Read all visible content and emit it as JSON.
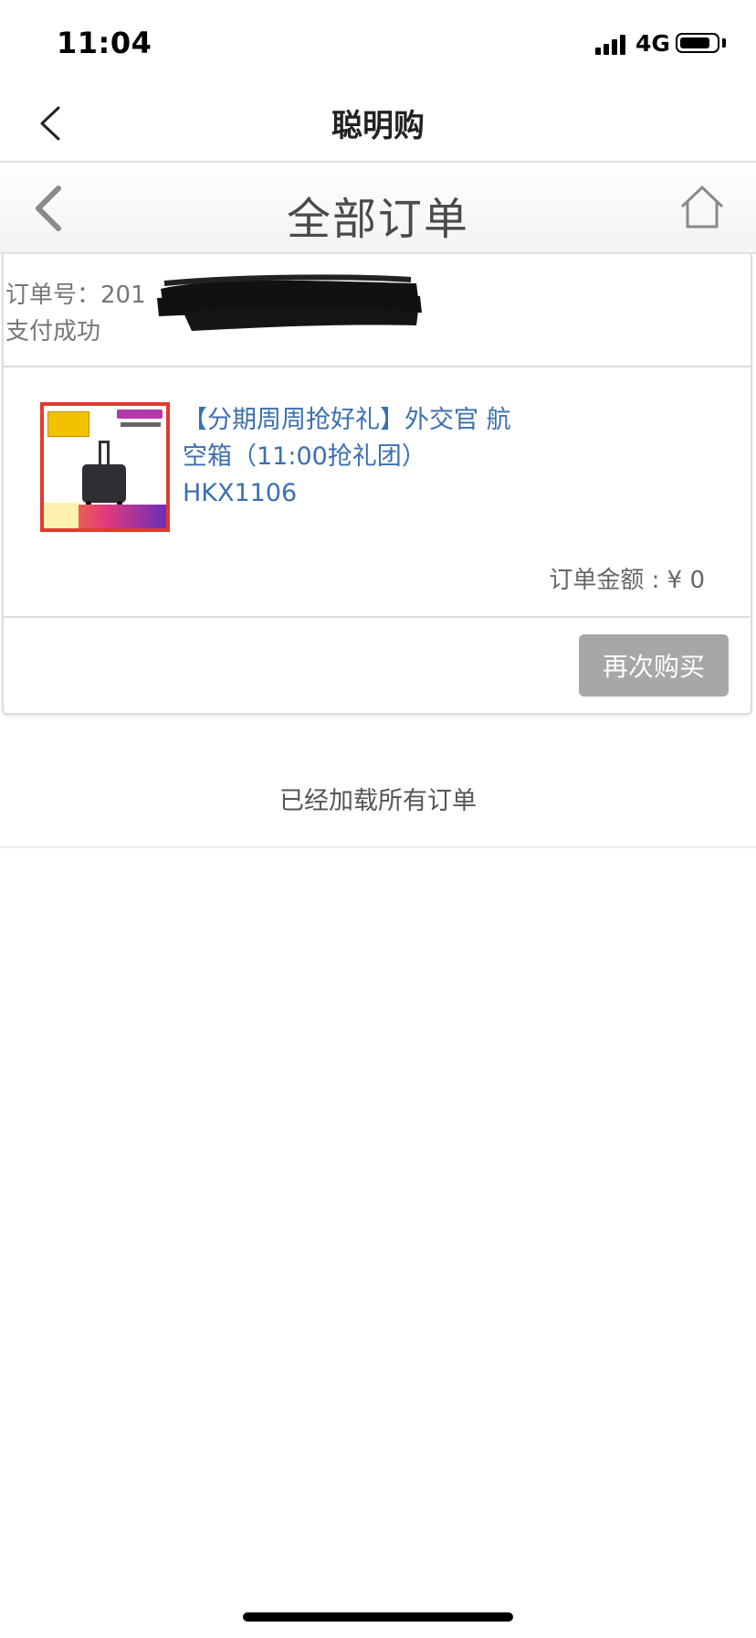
{
  "status_bar": {
    "time": "11:04",
    "network": "4G"
  },
  "app_header": {
    "title": "聪明购"
  },
  "page_header": {
    "title": "全部订单"
  },
  "order": {
    "number_label": "订单号：",
    "number_visible": "201",
    "status": "支付成功",
    "product_name": "【分期周周抢好礼】外交官 航空箱（11:00抢礼团）HKX1106",
    "amount_text": "订单金额 : ¥ 0",
    "rebuy_label": "再次购买"
  },
  "footer_note": "已经加载所有订单",
  "colors": {
    "link": "#3b6fb0",
    "button_bg": "#a7a7a7",
    "border": "#dcdcdc"
  }
}
